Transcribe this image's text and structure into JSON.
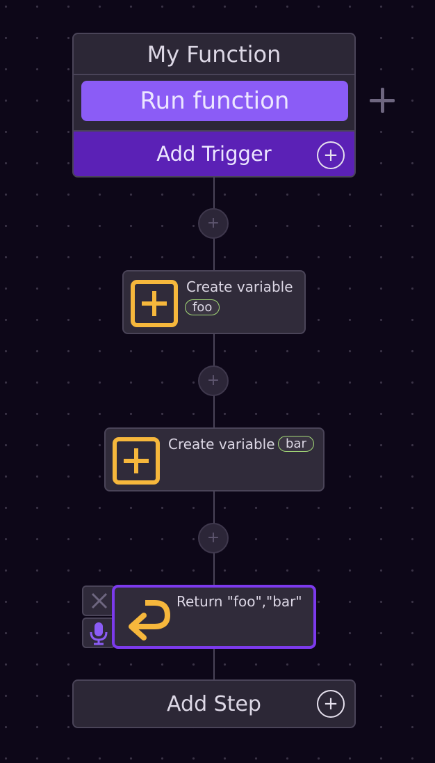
{
  "function": {
    "title": "My Function",
    "run_label": "Run function",
    "trigger_label": "Add Trigger",
    "trigger_add_symbol": "+"
  },
  "connector_plus_symbol": "+",
  "steps": [
    {
      "label": "Create variable",
      "tag": "foo",
      "icon": "add-box-icon"
    },
    {
      "label": "Create variable",
      "tag": "bar",
      "icon": "add-box-icon"
    },
    {
      "label": "Return \"foo\",\"bar\"",
      "icon": "return-arrow-icon"
    }
  ],
  "add_step": {
    "label": "Add Step",
    "symbol": "+"
  },
  "colors": {
    "background": "#0d0718",
    "accent_purple": "#8b5cf6",
    "trigger_purple": "#5b21b6",
    "selected_border": "#7c3aed",
    "icon_yellow": "#f6b73c",
    "tag_green": "#a3d977"
  }
}
